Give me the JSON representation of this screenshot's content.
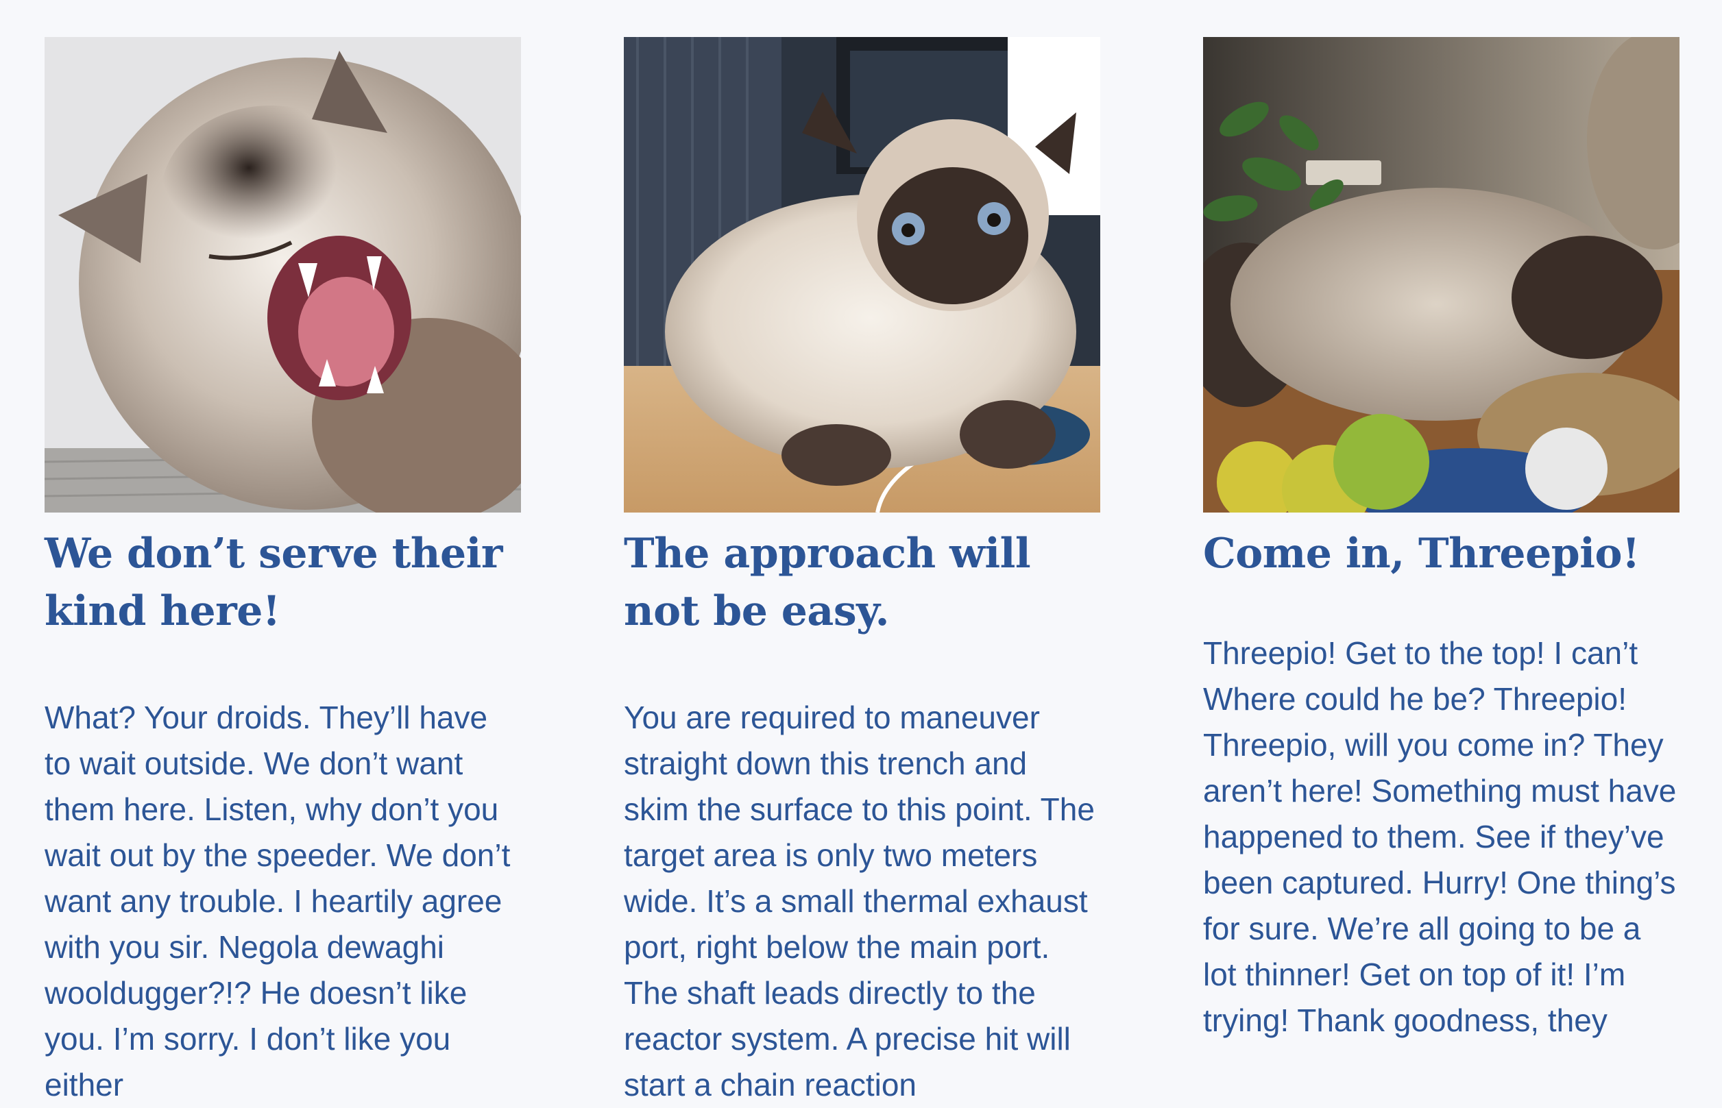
{
  "cards": [
    {
      "image": {
        "subject": "cat-yawning"
      },
      "title": "We don’t serve their kind here!",
      "body": "What? Your droids. They’ll have to wait outside. We don’t want them here. Listen, why don’t you wait out by the speeder. We don’t want any trouble. I heartily agree with you sir. Negola dewaghi wooldugger?!? He doesn’t like you. I’m sorry. I don’t like you either"
    },
    {
      "image": {
        "subject": "cat-on-desk"
      },
      "title": "The approach will not be easy.",
      "body": "You are required to maneuver straight down this trench and skim the surface to this point. The target area is only two meters wide. It’s a small thermal exhaust port, right below the main port. The shaft leads directly to the reactor system. A precise hit will start a chain reaction"
    },
    {
      "image": {
        "subject": "cat-lying-on-table"
      },
      "title": "Come in, Threepio!",
      "body": "Threepio! Get to the top! I can’t Where could he be? Threepio! Threepio, will you come in? They aren’t here! Something must have happened to them. See if they’ve been captured. Hurry! One thing’s for sure. We’re all going to be a lot thinner! Get on top of it! I’m trying! Thank goodness, they"
    }
  ],
  "colors": {
    "page_background": "#f7f8fb",
    "text": "#2c5596"
  }
}
